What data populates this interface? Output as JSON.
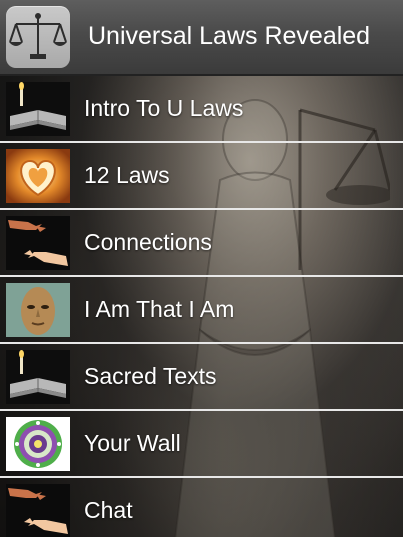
{
  "header": {
    "title": "Universal Laws Revealed",
    "logo_icon": "scales-of-justice-icon"
  },
  "menu": {
    "items": [
      {
        "label": "Intro To U Laws",
        "icon": "book-candle-icon"
      },
      {
        "label": "12 Laws",
        "icon": "heart-mandala-icon"
      },
      {
        "label": "Connections",
        "icon": "reaching-hands-icon"
      },
      {
        "label": "I Am That I Am",
        "icon": "face-mask-icon"
      },
      {
        "label": "Sacred Texts",
        "icon": "book-candle-icon"
      },
      {
        "label": "Your Wall",
        "icon": "mandala-icon"
      },
      {
        "label": "Chat",
        "icon": "reaching-hands-icon"
      }
    ]
  },
  "colors": {
    "header_bg": "#4a4a4a",
    "text": "#ffffff",
    "divider": "#e8e8e8"
  }
}
